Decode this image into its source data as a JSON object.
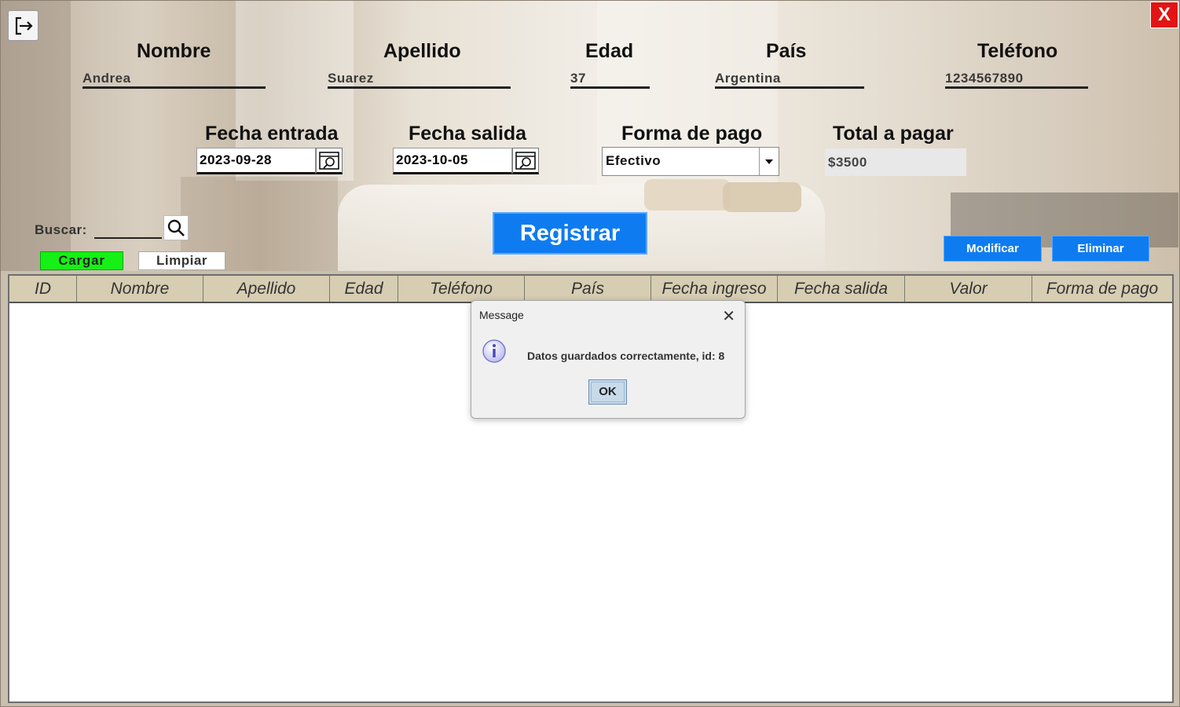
{
  "window": {
    "close_label": "X"
  },
  "form": {
    "nombre": {
      "label": "Nombre",
      "value": "Andrea"
    },
    "apellido": {
      "label": "Apellido",
      "value": "Suarez"
    },
    "edad": {
      "label": "Edad",
      "value": "37"
    },
    "pais": {
      "label": "País",
      "value": "Argentina"
    },
    "telefono": {
      "label": "Teléfono",
      "value": "1234567890"
    },
    "fecha_entrada": {
      "label": "Fecha entrada",
      "value": "2023-09-28"
    },
    "fecha_salida": {
      "label": "Fecha salida",
      "value": "2023-10-05"
    },
    "forma_pago": {
      "label": "Forma de pago",
      "value": "Efectivo"
    },
    "total": {
      "label": "Total a pagar",
      "value": "$3500"
    }
  },
  "search": {
    "label": "Buscar:",
    "value": ""
  },
  "buttons": {
    "cargar": "Cargar",
    "limpiar": "Limpiar",
    "registrar": "Registrar",
    "modificar": "Modificar",
    "eliminar": "Eliminar"
  },
  "table": {
    "columns": [
      "ID",
      "Nombre",
      "Apellido",
      "Edad",
      "Teléfono",
      "País",
      "Fecha ingreso",
      "Fecha salida",
      "Valor",
      "Forma de pago"
    ],
    "rows": []
  },
  "dialog": {
    "title": "Message",
    "message": "Datos guardados correctamente, id: 8",
    "ok_label": "OK"
  },
  "colors": {
    "primary_button": "#0e7cf0",
    "cargar_button": "#16f016",
    "close_button": "#e21414",
    "table_header": "#d6cdb3"
  },
  "icons": {
    "exit": "exit-icon",
    "calendar": "calendar-icon",
    "search": "search-icon",
    "dropdown": "chevron-down-icon",
    "info": "info-icon"
  }
}
